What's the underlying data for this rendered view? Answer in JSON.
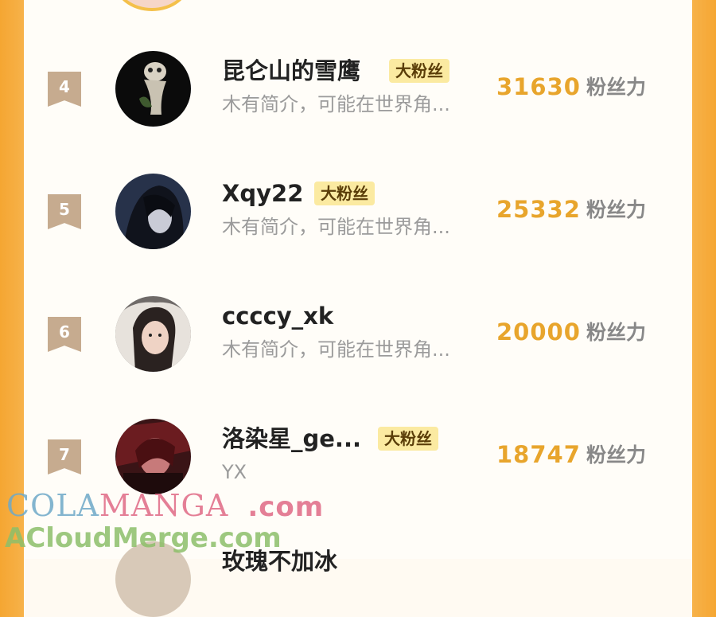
{
  "ranking": [
    {
      "rank": "4",
      "name": "昆仑山的雪鹰",
      "badge": "大粉丝",
      "bio": "木有简介，可能在世界角...",
      "score": "31630",
      "unit": "粉丝力"
    },
    {
      "rank": "5",
      "name": "Xqy22",
      "badge": "大粉丝",
      "bio": "木有简介，可能在世界角...",
      "score": "25332",
      "unit": "粉丝力"
    },
    {
      "rank": "6",
      "name": "ccccy_xk",
      "badge": "",
      "bio": "木有简介，可能在世界角...",
      "score": "20000",
      "unit": "粉丝力"
    },
    {
      "rank": "7",
      "name": "洛染星_ge...",
      "badge": "大粉丝",
      "bio": "YX",
      "score": "18747",
      "unit": "粉丝力"
    }
  ],
  "next_partial_name": "玫瑰不加冰",
  "watermark": {
    "line1_a": "COLA",
    "line1_b": "MANGA",
    "line1_c": ".com",
    "line2": "ACloudMerge.com"
  },
  "colors": {
    "accent": "#e8a52c",
    "badge_bg": "#fbeaa1",
    "rank_bg": "#c6ab8f",
    "frame": "#f5a632"
  },
  "icons": {
    "rank": "ribbon-rank-icon"
  }
}
